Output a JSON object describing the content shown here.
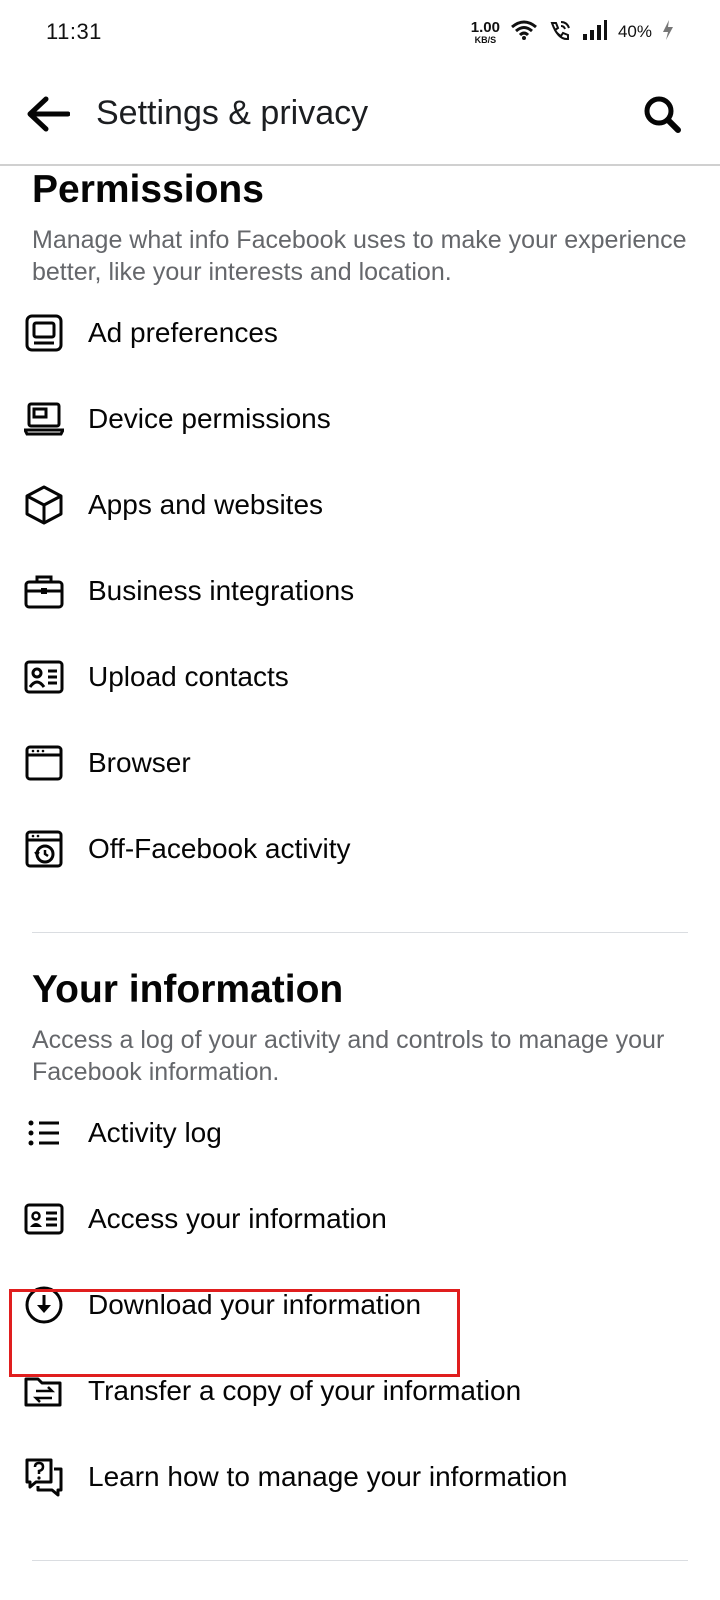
{
  "status_bar": {
    "time": "11:31",
    "net_speed_value": "1.00",
    "net_speed_unit": "KB/S",
    "battery": "40%"
  },
  "app_bar": {
    "title": "Settings & privacy"
  },
  "permissions": {
    "title": "Permissions",
    "description": "Manage what info Facebook uses to make your experience better, like your interests and location.",
    "items": [
      {
        "label": "Ad preferences",
        "icon": "ad-preferences-icon"
      },
      {
        "label": "Device permissions",
        "icon": "device-icon"
      },
      {
        "label": "Apps and websites",
        "icon": "cube-icon"
      },
      {
        "label": "Business integrations",
        "icon": "briefcase-icon"
      },
      {
        "label": "Upload contacts",
        "icon": "contact-card-icon"
      },
      {
        "label": "Browser",
        "icon": "browser-icon"
      },
      {
        "label": "Off-Facebook activity",
        "icon": "history-icon"
      }
    ]
  },
  "your_information": {
    "title": "Your information",
    "description": "Access a log of your activity and controls to manage your Facebook information.",
    "items": [
      {
        "label": "Activity log",
        "icon": "list-icon"
      },
      {
        "label": "Access your information",
        "icon": "id-card-icon"
      },
      {
        "label": "Download your information",
        "icon": "download-icon"
      },
      {
        "label": "Transfer a copy of your information",
        "icon": "transfer-folder-icon"
      },
      {
        "label": "Learn how to manage your information",
        "icon": "help-chat-icon"
      }
    ]
  },
  "colors": {
    "highlight": "#e01e1e",
    "secondary_text": "#65676b",
    "primary_text": "#050505"
  }
}
